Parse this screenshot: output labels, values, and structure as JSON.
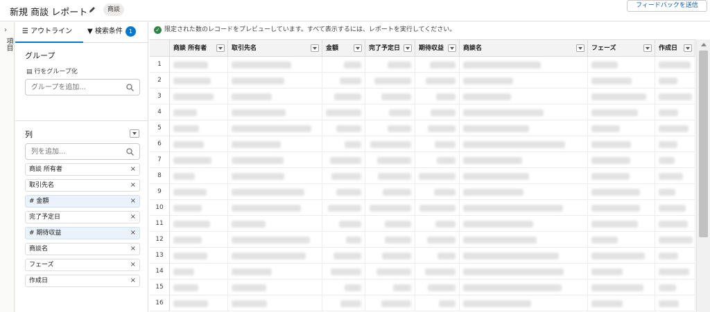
{
  "header": {
    "title": "新規 商談 レポート",
    "object_badge": "商談",
    "feedback_button": "フィードバックを送信"
  },
  "strip": {
    "label": "項目"
  },
  "panel": {
    "tabs": {
      "outline": "アウトライン",
      "filters": "検索条件",
      "filter_count": "1"
    },
    "groups": {
      "title": "グループ",
      "group_rows_link": "行をグループ化",
      "search_placeholder": "グループを追加..."
    },
    "columns": {
      "title": "列",
      "search_placeholder": "列を追加...",
      "items": [
        {
          "label": "商談 所有者",
          "numeric": false
        },
        {
          "label": "取引先名",
          "numeric": false
        },
        {
          "label": "# 金額",
          "numeric": true
        },
        {
          "label": "完了予定日",
          "numeric": false
        },
        {
          "label": "# 期待収益",
          "numeric": true
        },
        {
          "label": "商談名",
          "numeric": false
        },
        {
          "label": "フェーズ",
          "numeric": false
        },
        {
          "label": "作成日",
          "numeric": false
        }
      ]
    }
  },
  "main": {
    "banner": "限定された数のレコードをプレビューしています。すべて表示するには、レポートを実行してください。",
    "table": {
      "headers": [
        "商談 所有者",
        "取引先名",
        "金額",
        "完了予定日",
        "期待収益",
        "商談名",
        "フェーズ",
        "作成日"
      ],
      "row_numbers": [
        "1",
        "2",
        "3",
        "4",
        "5",
        "6",
        "7",
        "8",
        "9",
        "10",
        "11",
        "12",
        "13",
        "14",
        "15",
        "16"
      ]
    }
  },
  "colors": {
    "accent": "#0176d3",
    "success": "#2e844a",
    "numeric_pill": "#eaf3fb"
  }
}
